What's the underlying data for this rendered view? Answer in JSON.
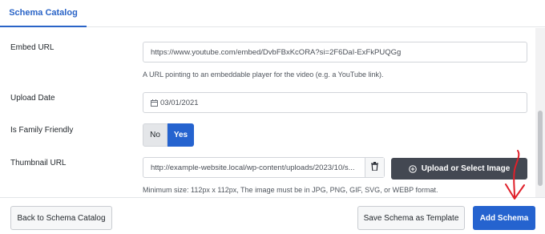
{
  "tabs": [
    {
      "label": "Schema Catalog",
      "active": true
    }
  ],
  "fields": {
    "embed_url": {
      "label": "Embed URL",
      "value": "https://www.youtube.com/embed/DvbFBxKcORA?si=2F6DaI-ExFkPUQGg",
      "help": "A URL pointing to an embeddable player for the video (e.g. a YouTube link)."
    },
    "upload_date": {
      "label": "Upload Date",
      "value": "03/01/2021",
      "icon": "calendar-icon"
    },
    "family_friendly": {
      "label": "Is Family Friendly",
      "options": [
        "No",
        "Yes"
      ],
      "selected": "Yes"
    },
    "thumbnail_url": {
      "label": "Thumbnail URL",
      "value": "http://example-website.local/wp-content/uploads/2023/10/s...",
      "upload_label": "Upload or Select Image",
      "help": "Minimum size: 112px x 112px, The image must be in JPG, PNG, GIF, SVG, or WEBP format.",
      "icons": [
        "trash-icon",
        "plus-circle-icon"
      ]
    }
  },
  "footer": {
    "back_label": "Back to Schema Catalog",
    "save_template_label": "Save Schema as Template",
    "add_label": "Add Schema"
  },
  "colors": {
    "accent": "#2563cf",
    "tab_active": "#2a64c7",
    "upload_button": "#434852",
    "annotation_arrow": "#e0202a"
  }
}
